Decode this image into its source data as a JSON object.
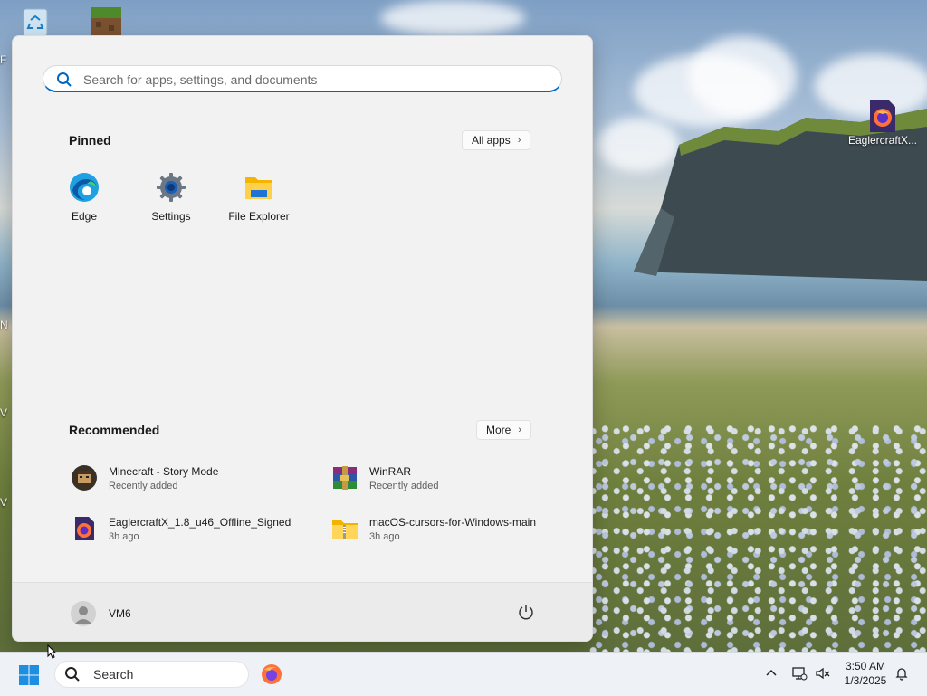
{
  "desktop": {
    "icons": [
      {
        "label": "EaglercraftX...",
        "icon": "firefox-file-icon"
      }
    ],
    "partial_left_labels": [
      "F",
      "N",
      "V",
      "V"
    ]
  },
  "start_menu": {
    "search": {
      "placeholder": "Search for apps, settings, and documents",
      "value": ""
    },
    "pinned": {
      "title": "Pinned",
      "all_apps_label": "All apps",
      "apps": [
        {
          "label": "Edge",
          "icon": "edge-icon"
        },
        {
          "label": "Settings",
          "icon": "settings-gear-icon"
        },
        {
          "label": "File Explorer",
          "icon": "folder-icon"
        }
      ]
    },
    "recommended": {
      "title": "Recommended",
      "more_label": "More",
      "items": [
        {
          "name": "Minecraft - Story Mode",
          "sub": "Recently added",
          "icon": "minecraft-story-mode-icon"
        },
        {
          "name": "WinRAR",
          "sub": "Recently added",
          "icon": "winrar-icon"
        },
        {
          "name": "EaglercraftX_1.8_u46_Offline_Signed",
          "sub": "3h ago",
          "icon": "firefox-file-icon"
        },
        {
          "name": "macOS-cursors-for-Windows-main",
          "sub": "3h ago",
          "icon": "zip-folder-icon"
        }
      ]
    },
    "user": {
      "name": "VM6"
    }
  },
  "taskbar": {
    "search_label": "Search",
    "clock": {
      "time": "3:50 AM",
      "date": "1/3/2025"
    },
    "pinned_apps": [
      {
        "icon": "firefox-icon"
      }
    ]
  },
  "colors": {
    "accent": "#0067c0",
    "start_bg": "#f2f2f2",
    "taskbar_bg": "#eef1f6"
  }
}
